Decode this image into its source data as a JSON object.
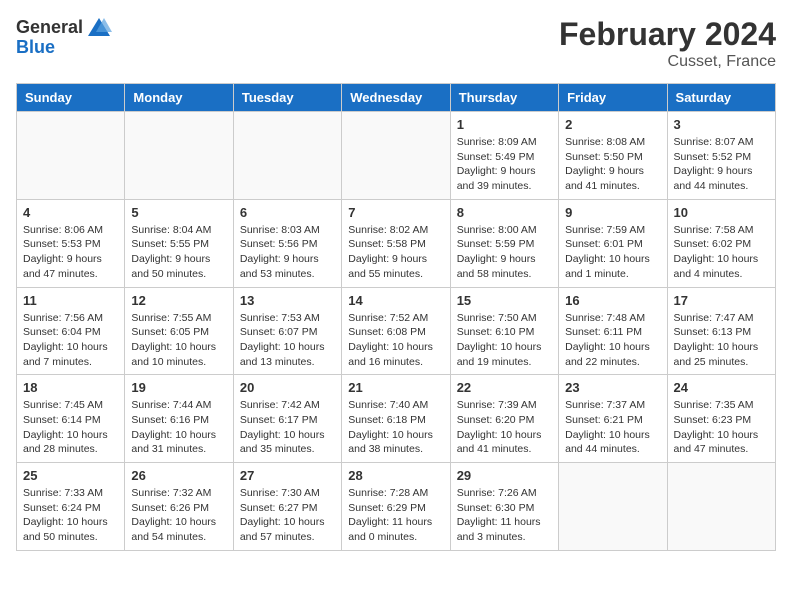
{
  "header": {
    "logo_general": "General",
    "logo_blue": "Blue",
    "title": "February 2024",
    "subtitle": "Cusset, France"
  },
  "columns": [
    "Sunday",
    "Monday",
    "Tuesday",
    "Wednesday",
    "Thursday",
    "Friday",
    "Saturday"
  ],
  "weeks": [
    [
      {
        "day": "",
        "info": ""
      },
      {
        "day": "",
        "info": ""
      },
      {
        "day": "",
        "info": ""
      },
      {
        "day": "",
        "info": ""
      },
      {
        "day": "1",
        "info": "Sunrise: 8:09 AM\nSunset: 5:49 PM\nDaylight: 9 hours and 39 minutes."
      },
      {
        "day": "2",
        "info": "Sunrise: 8:08 AM\nSunset: 5:50 PM\nDaylight: 9 hours and 41 minutes."
      },
      {
        "day": "3",
        "info": "Sunrise: 8:07 AM\nSunset: 5:52 PM\nDaylight: 9 hours and 44 minutes."
      }
    ],
    [
      {
        "day": "4",
        "info": "Sunrise: 8:06 AM\nSunset: 5:53 PM\nDaylight: 9 hours and 47 minutes."
      },
      {
        "day": "5",
        "info": "Sunrise: 8:04 AM\nSunset: 5:55 PM\nDaylight: 9 hours and 50 minutes."
      },
      {
        "day": "6",
        "info": "Sunrise: 8:03 AM\nSunset: 5:56 PM\nDaylight: 9 hours and 53 minutes."
      },
      {
        "day": "7",
        "info": "Sunrise: 8:02 AM\nSunset: 5:58 PM\nDaylight: 9 hours and 55 minutes."
      },
      {
        "day": "8",
        "info": "Sunrise: 8:00 AM\nSunset: 5:59 PM\nDaylight: 9 hours and 58 minutes."
      },
      {
        "day": "9",
        "info": "Sunrise: 7:59 AM\nSunset: 6:01 PM\nDaylight: 10 hours and 1 minute."
      },
      {
        "day": "10",
        "info": "Sunrise: 7:58 AM\nSunset: 6:02 PM\nDaylight: 10 hours and 4 minutes."
      }
    ],
    [
      {
        "day": "11",
        "info": "Sunrise: 7:56 AM\nSunset: 6:04 PM\nDaylight: 10 hours and 7 minutes."
      },
      {
        "day": "12",
        "info": "Sunrise: 7:55 AM\nSunset: 6:05 PM\nDaylight: 10 hours and 10 minutes."
      },
      {
        "day": "13",
        "info": "Sunrise: 7:53 AM\nSunset: 6:07 PM\nDaylight: 10 hours and 13 minutes."
      },
      {
        "day": "14",
        "info": "Sunrise: 7:52 AM\nSunset: 6:08 PM\nDaylight: 10 hours and 16 minutes."
      },
      {
        "day": "15",
        "info": "Sunrise: 7:50 AM\nSunset: 6:10 PM\nDaylight: 10 hours and 19 minutes."
      },
      {
        "day": "16",
        "info": "Sunrise: 7:48 AM\nSunset: 6:11 PM\nDaylight: 10 hours and 22 minutes."
      },
      {
        "day": "17",
        "info": "Sunrise: 7:47 AM\nSunset: 6:13 PM\nDaylight: 10 hours and 25 minutes."
      }
    ],
    [
      {
        "day": "18",
        "info": "Sunrise: 7:45 AM\nSunset: 6:14 PM\nDaylight: 10 hours and 28 minutes."
      },
      {
        "day": "19",
        "info": "Sunrise: 7:44 AM\nSunset: 6:16 PM\nDaylight: 10 hours and 31 minutes."
      },
      {
        "day": "20",
        "info": "Sunrise: 7:42 AM\nSunset: 6:17 PM\nDaylight: 10 hours and 35 minutes."
      },
      {
        "day": "21",
        "info": "Sunrise: 7:40 AM\nSunset: 6:18 PM\nDaylight: 10 hours and 38 minutes."
      },
      {
        "day": "22",
        "info": "Sunrise: 7:39 AM\nSunset: 6:20 PM\nDaylight: 10 hours and 41 minutes."
      },
      {
        "day": "23",
        "info": "Sunrise: 7:37 AM\nSunset: 6:21 PM\nDaylight: 10 hours and 44 minutes."
      },
      {
        "day": "24",
        "info": "Sunrise: 7:35 AM\nSunset: 6:23 PM\nDaylight: 10 hours and 47 minutes."
      }
    ],
    [
      {
        "day": "25",
        "info": "Sunrise: 7:33 AM\nSunset: 6:24 PM\nDaylight: 10 hours and 50 minutes."
      },
      {
        "day": "26",
        "info": "Sunrise: 7:32 AM\nSunset: 6:26 PM\nDaylight: 10 hours and 54 minutes."
      },
      {
        "day": "27",
        "info": "Sunrise: 7:30 AM\nSunset: 6:27 PM\nDaylight: 10 hours and 57 minutes."
      },
      {
        "day": "28",
        "info": "Sunrise: 7:28 AM\nSunset: 6:29 PM\nDaylight: 11 hours and 0 minutes."
      },
      {
        "day": "29",
        "info": "Sunrise: 7:26 AM\nSunset: 6:30 PM\nDaylight: 11 hours and 3 minutes."
      },
      {
        "day": "",
        "info": ""
      },
      {
        "day": "",
        "info": ""
      }
    ]
  ]
}
